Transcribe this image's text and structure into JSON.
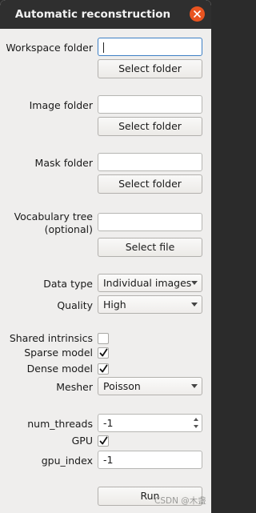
{
  "window": {
    "title": "Automatic reconstruction"
  },
  "workspace": {
    "label": "Workspace folder",
    "value": "",
    "button": "Select folder"
  },
  "image": {
    "label": "Image folder",
    "value": "",
    "button": "Select folder"
  },
  "mask": {
    "label": "Mask folder",
    "value": "",
    "button": "Select folder"
  },
  "vocab": {
    "label_line1": "Vocabulary tree",
    "label_line2": "(optional)",
    "value": "",
    "button": "Select file"
  },
  "data_type": {
    "label": "Data type",
    "selected": "Individual images"
  },
  "quality": {
    "label": "Quality",
    "selected": "High"
  },
  "shared_intrinsics": {
    "label": "Shared intrinsics",
    "checked": false
  },
  "sparse_model": {
    "label": "Sparse model",
    "checked": true
  },
  "dense_model": {
    "label": "Dense model",
    "checked": true
  },
  "mesher": {
    "label": "Mesher",
    "selected": "Poisson"
  },
  "num_threads": {
    "label": "num_threads",
    "value": "-1"
  },
  "gpu": {
    "label": "GPU",
    "checked": true
  },
  "gpu_index": {
    "label": "gpu_index",
    "value": "-1"
  },
  "run": {
    "label": "Run"
  },
  "watermark": "CSDN @木盏",
  "colors": {
    "accent": "#e95420",
    "focus": "#3d7fc4",
    "titlebar": "#2f2f2f",
    "background": "#efeeed"
  }
}
